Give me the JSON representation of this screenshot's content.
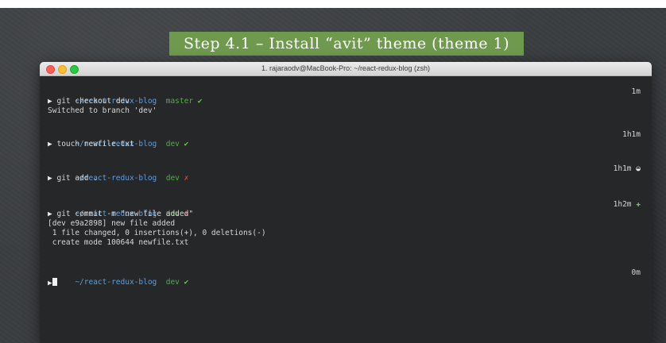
{
  "slide": {
    "title": "Step 4.1 – Install “avit” theme (theme 1)"
  },
  "window": {
    "title": "1. rajaraodv@MacBook-Pro: ~/react-redux-blog (zsh)",
    "controls": [
      "close",
      "minimize",
      "maximize"
    ]
  },
  "terminal": {
    "prompt_symbol": "▶",
    "blocks": [
      {
        "path": "~/react-redux-blog",
        "branch": "master",
        "status_icon": "✔",
        "timer": "1m",
        "timer_mark": "",
        "command": "git checkout dev",
        "output": [
          "Switched to branch 'dev'"
        ]
      },
      {
        "path": "~/react-redux-blog",
        "branch": "dev",
        "status_icon": "✔",
        "timer": "1h1m",
        "timer_mark": "",
        "command": "touch newfile.txt",
        "output": []
      },
      {
        "path": "~/react-redux-blog",
        "branch": "dev",
        "status_icon": "✗",
        "timer": "1h1m",
        "timer_mark": "◒",
        "command": "git add .",
        "output": []
      },
      {
        "path": "~/react-redux-blog",
        "branch": "dev",
        "status_icon": "✗",
        "timer": "1h2m",
        "timer_mark": "✚",
        "command": "git commit -m \"new file added\"",
        "output": [
          "[dev e9a2898] new file added",
          " 1 file changed, 0 insertions(+), 0 deletions(-)",
          " create mode 100644 newfile.txt"
        ]
      },
      {
        "path": "~/react-redux-blog",
        "branch": "dev",
        "status_icon": "✔",
        "timer": "0m",
        "timer_mark": "",
        "command": "",
        "output": []
      }
    ]
  },
  "colors": {
    "path": "#5b9fe0",
    "branch": "#4fb045",
    "clean_check": "#5fd046",
    "dirty_cross": "#e04444",
    "title_banner": "#6f9a4e",
    "terminal_bg": "#262729"
  }
}
